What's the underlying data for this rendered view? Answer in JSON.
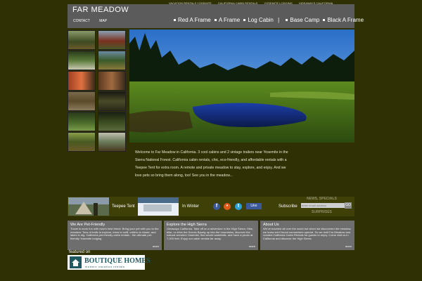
{
  "header": {
    "title": "FAR MEADOW",
    "top_links": [
      "VACATION RENTALS YOSEMITE",
      "CALIFORNIA CABIN RENTALS",
      "YOSEMITE LODGING",
      "HIDEAWAYS CALIFORNIA"
    ],
    "nav_left": [
      "CONTACT",
      "MAP"
    ],
    "nav_right": [
      "Red A Frame",
      "A Frame",
      "Log Cabin",
      "Base Camp",
      "Black A Frame"
    ]
  },
  "intro": {
    "text": "Welcome to Far Meadow in California. 3 cool cabins and 2 vintage trailers near Yosemite in the Sierra National Forest. California cabin rentals, chic, eco-friendly, and affordable rentals with a Teepee Tent for extra room. A remote and private meadow to stay, explore, and enjoy. And we love pets so bring them along, too! See you in the meadow..."
  },
  "strip": {
    "teepee_label": "Teepee Tent",
    "winter_label": "In Winter",
    "like_label": "Like",
    "subscribe_label": "Subscribe",
    "news_label": "NEWS, SPECIALS",
    "surprises_label": "SURPRISES",
    "email_placeholder": "enter email address",
    "go_label": "GO"
  },
  "boxes": [
    {
      "title": "We Are Pet-Friendly",
      "body": "Travel is more fun with man's best friend. Bring your pet with you to the meadow. Tons of trails to explore, trees to sniff, critters to chase, and lakes to dig. California pet-friendly cabin rentals - the ultimate pet-friendly Yosemite lodging.",
      "more": "more"
    },
    {
      "title": "Explore the High Sierra",
      "body": "Getaways California. Take off on a adventure in the High Sierra. Hike, bike, or drive the Scenic Byway up into the mountains, discover the natural wonders Yosemite, find secret waterfalls, and have a picnic at 7,000 feet. Enjoy our cabin rentals far away.",
      "more": "more"
    },
    {
      "title": "About Us",
      "body": "We've traveled all over the world but when we discovered the meadow, we knew we'd found somewhere special. So we built Far Meadow and created California Cabin Rentals for guests to enjoy. Come visit us in California and discover the High Sierra.",
      "more": "more"
    }
  ],
  "featured": {
    "label": "featured on",
    "brand": "BOUTIQUE HOMES",
    "tagline": "modern vacation rentals"
  },
  "colors": {
    "background": "#2f3004",
    "bar": "#5b5b5b",
    "box": "#6e6e6e",
    "brand": "#1f5a63"
  }
}
